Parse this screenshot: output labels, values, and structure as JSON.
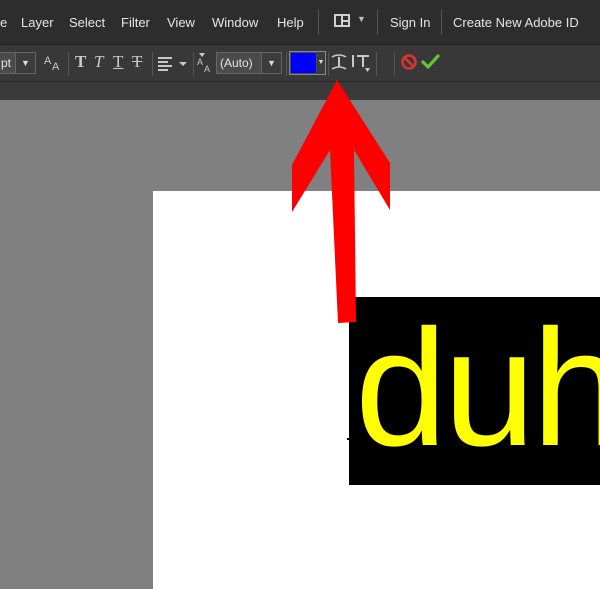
{
  "menu": {
    "items": [
      "e",
      "Layer",
      "Select",
      "Filter",
      "View",
      "Window",
      "Help"
    ],
    "sign_in": "Sign In",
    "create_id": "Create New Adobe ID",
    "layout_icon": "workspace-layout-icon"
  },
  "options": {
    "font_size_value": "pt",
    "leading_value": "(Auto)",
    "text_color": "#0000ff",
    "type_buttons": [
      "T",
      "T",
      "T",
      "T"
    ],
    "cancel_icon": "cancel-icon",
    "commit_icon": "checkmark-icon"
  },
  "canvas": {
    "text_content": "duh",
    "text_color": "#ffff00",
    "highlight_color": "#000000"
  },
  "annotation": {
    "arrow_color": "#ff0000"
  }
}
